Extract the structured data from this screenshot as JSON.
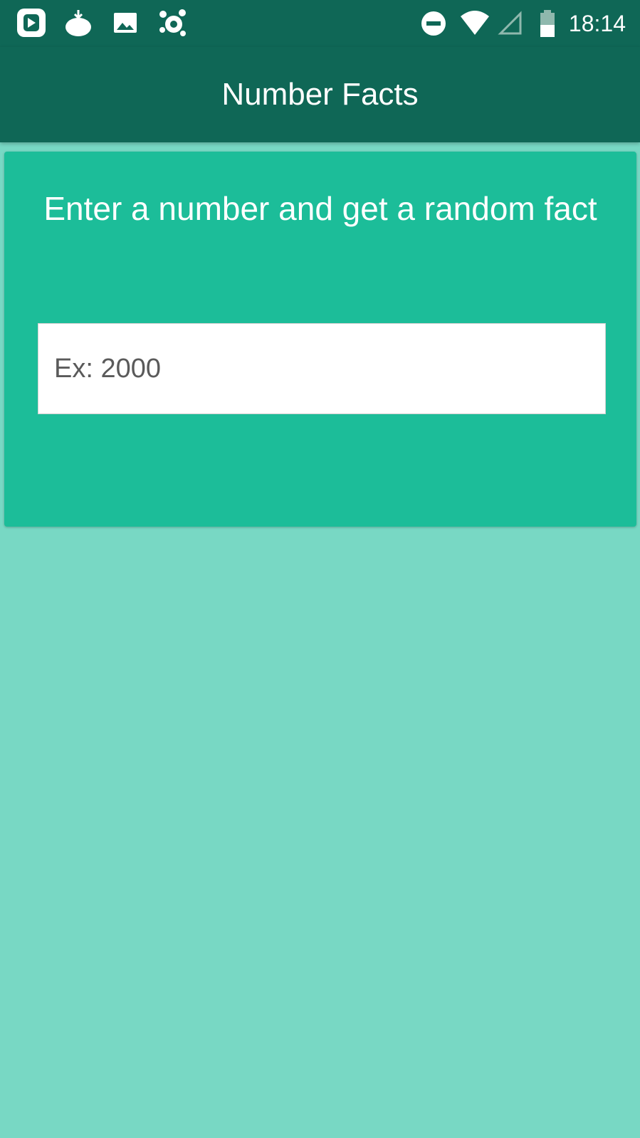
{
  "status_bar": {
    "time": "18:14",
    "left_icons": [
      "play-store-icon",
      "tomato-download-icon",
      "gallery-icon",
      "avast-icon"
    ],
    "right_icons": [
      "do-not-disturb-icon",
      "wifi-icon",
      "signal-icon",
      "battery-icon"
    ]
  },
  "app_bar": {
    "title": "Number Facts"
  },
  "card": {
    "heading": "Enter a number and get a random fact",
    "input_placeholder": "Ex: 2000",
    "input_value": ""
  },
  "colors": {
    "app_bar": "#0f6756",
    "card": "#1cbd99",
    "background": "#78d8c4"
  }
}
